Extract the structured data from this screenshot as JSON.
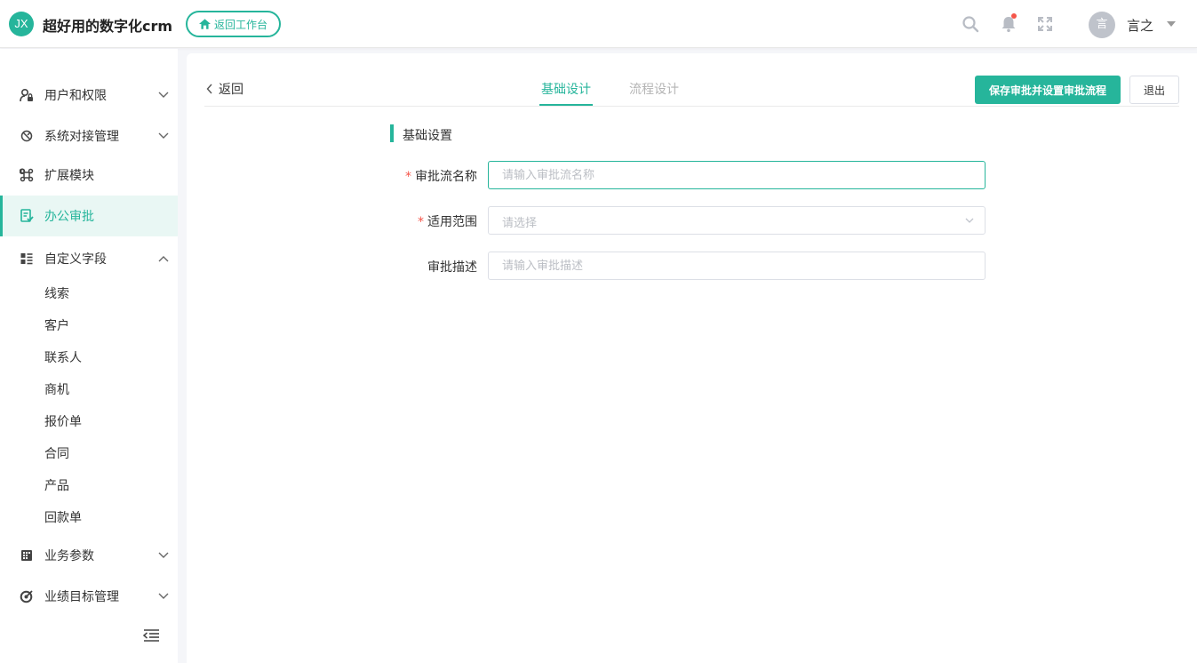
{
  "header": {
    "logo_text": "JX",
    "app_title": "超好用的数字化crm",
    "back_workbench_label": "返回工作台",
    "avatar_text": "言",
    "username": "言之",
    "icons": [
      "search-icon",
      "bell-icon",
      "fullscreen-icon",
      "chevron-down-icon"
    ],
    "notification_dot_color": "#f5554a"
  },
  "sidebar": {
    "items": [
      {
        "label": "用户和权限",
        "icon": "user-lock-icon",
        "expandable": true
      },
      {
        "label": "系统对接管理",
        "icon": "integration-icon",
        "expandable": true
      },
      {
        "label": "扩展模块",
        "icon": "command-icon",
        "expandable": false
      },
      {
        "label": "办公审批",
        "icon": "approval-icon",
        "expandable": false,
        "active": true
      },
      {
        "label": "自定义字段",
        "icon": "fields-icon",
        "expandable": true,
        "expanded": true
      },
      {
        "label": "业务参数",
        "icon": "grid-icon",
        "expandable": true
      },
      {
        "label": "业绩目标管理",
        "icon": "target-icon",
        "expandable": true
      }
    ],
    "sub_items": [
      "线索",
      "客户",
      "联系人",
      "商机",
      "报价单",
      "合同",
      "产品",
      "回款单"
    ]
  },
  "main": {
    "back_label": "返回",
    "tabs": [
      {
        "label": "基础设计",
        "active": true
      },
      {
        "label": "流程设计",
        "active": false
      }
    ],
    "save_button": "保存审批并设置审批流程",
    "exit_button": "退出",
    "section_title": "基础设置",
    "form": {
      "name_label": "审批流名称",
      "name_placeholder": "请输入审批流名称",
      "scope_label": "适用范围",
      "scope_placeholder": "请选择",
      "desc_label": "审批描述",
      "desc_placeholder": "请输入审批描述"
    }
  },
  "colors": {
    "accent": "#26b59b",
    "required": "#f5554a",
    "active_bg": "#e9f7f4"
  }
}
